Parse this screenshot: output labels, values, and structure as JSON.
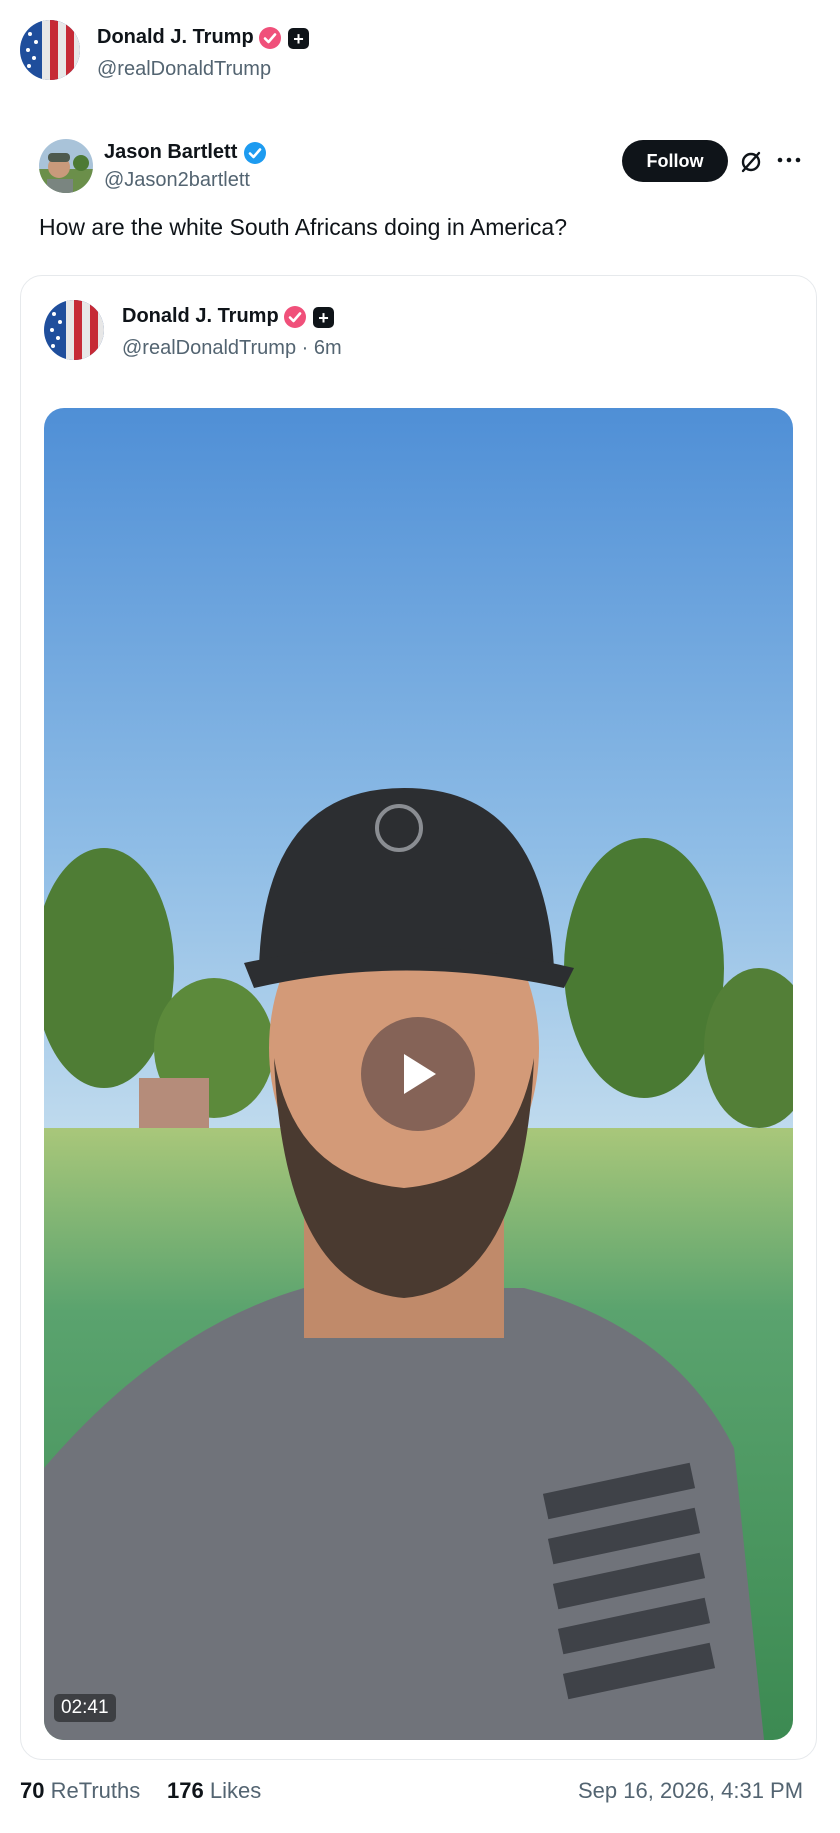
{
  "post": {
    "author_name": "Donald J. Trump",
    "author_handle": "@realDonaldTrump"
  },
  "quoted_post": {
    "author_name": "Jason Bartlett",
    "author_handle": "@Jason2bartlett",
    "follow_label": "Follow",
    "text": "How are the white South Africans doing in America?"
  },
  "embedded_post": {
    "author_name": "Donald J. Trump",
    "author_handle": "@realDonaldTrump · 6m",
    "video": {
      "duration": "02:41"
    }
  },
  "stats": {
    "retruths_count": "70",
    "retruths_label": "ReTruths",
    "likes_count": "176",
    "likes_label": "Likes",
    "timestamp": "Sep 16, 2026, 4:31 PM"
  },
  "colors": {
    "verified_pink": "#f0507a",
    "verified_blue": "#1d9bf0",
    "follow_bg": "#0f1419",
    "muted_text": "#536471"
  }
}
